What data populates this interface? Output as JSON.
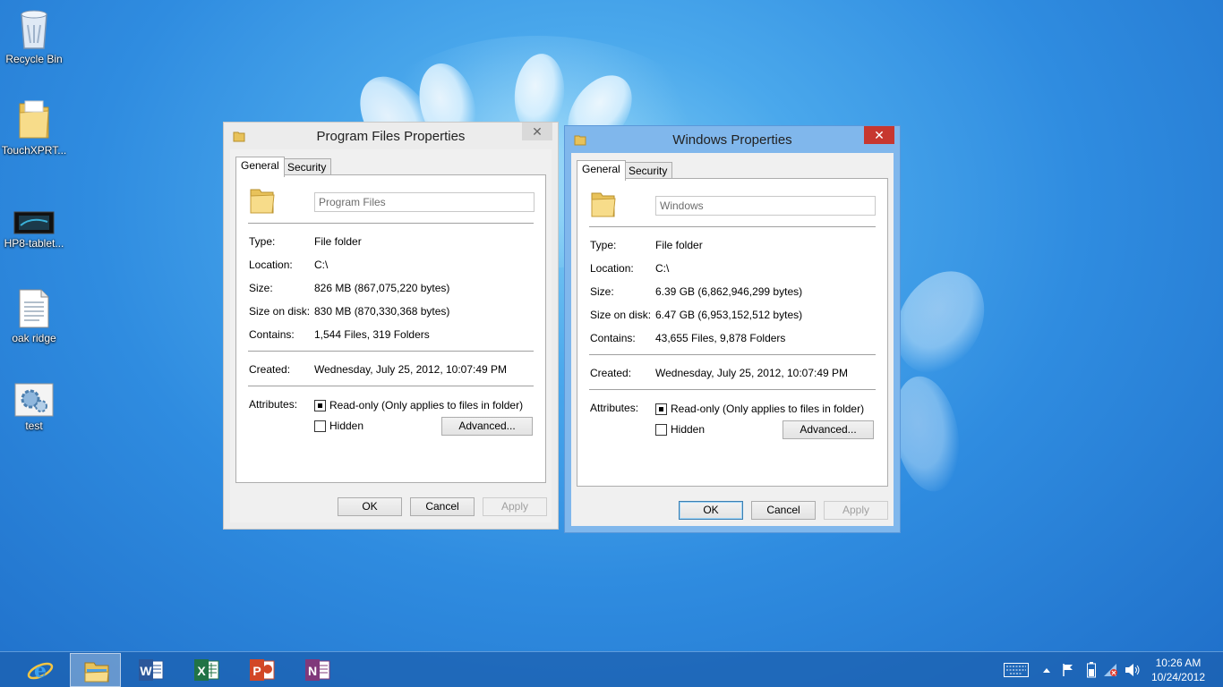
{
  "desktop": {
    "icons": [
      {
        "label": "Recycle Bin",
        "icon": "recycle-bin-icon"
      },
      {
        "label": "TouchXPRT...",
        "icon": "folder-icon"
      },
      {
        "label": "HP8-tablet...",
        "icon": "video-file-icon"
      },
      {
        "label": "oak ridge",
        "icon": "text-document-icon"
      },
      {
        "label": "test",
        "icon": "settings-file-icon"
      }
    ]
  },
  "dialog_program_files": {
    "title": "Program Files Properties",
    "close": "✕",
    "tabs": [
      "General",
      "Security"
    ],
    "name_value": "Program Files",
    "rows": [
      {
        "label": "Type:",
        "value": "File folder"
      },
      {
        "label": "Location:",
        "value": "C:\\"
      },
      {
        "label": "Size:",
        "value": "826 MB (867,075,220 bytes)"
      },
      {
        "label": "Size on disk:",
        "value": "830 MB (870,330,368 bytes)"
      },
      {
        "label": "Contains:",
        "value": "1,544 Files, 319 Folders"
      }
    ],
    "created_label": "Created:",
    "created_value": "Wednesday, July 25, 2012, 10:07:49 PM",
    "attributes_label": "Attributes:",
    "readonly_label": "Read-only (Only applies to files in folder)",
    "hidden_label": "Hidden",
    "advanced_label": "Advanced...",
    "ok_label": "OK",
    "cancel_label": "Cancel",
    "apply_label": "Apply"
  },
  "dialog_windows": {
    "title": "Windows Properties",
    "close": "✕",
    "tabs": [
      "General",
      "Security"
    ],
    "name_value": "Windows",
    "rows": [
      {
        "label": "Type:",
        "value": "File folder"
      },
      {
        "label": "Location:",
        "value": "C:\\"
      },
      {
        "label": "Size:",
        "value": "6.39 GB (6,862,946,299 bytes)"
      },
      {
        "label": "Size on disk:",
        "value": "6.47 GB (6,953,152,512 bytes)"
      },
      {
        "label": "Contains:",
        "value": "43,655 Files, 9,878 Folders"
      }
    ],
    "created_label": "Created:",
    "created_value": "Wednesday, July 25, 2012, 10:07:49 PM",
    "attributes_label": "Attributes:",
    "readonly_label": "Read-only (Only applies to files in folder)",
    "hidden_label": "Hidden",
    "advanced_label": "Advanced...",
    "ok_label": "OK",
    "cancel_label": "Cancel",
    "apply_label": "Apply"
  },
  "taskbar": {
    "apps": [
      {
        "icon": "internet-explorer-icon",
        "active": false
      },
      {
        "icon": "file-explorer-icon",
        "active": true
      },
      {
        "icon": "word-icon",
        "active": false
      },
      {
        "icon": "excel-icon",
        "active": false
      },
      {
        "icon": "powerpoint-icon",
        "active": false
      },
      {
        "icon": "onenote-icon",
        "active": false
      }
    ],
    "tray": {
      "keyboard_icon": "touch-keyboard-icon",
      "show_hidden_icon": "chevron-up-icon",
      "flag_icon": "action-center-flag-icon",
      "battery_icon": "battery-icon",
      "network_icon": "network-disconnected-icon",
      "volume_icon": "volume-icon"
    },
    "time": "10:26 AM",
    "date": "10/24/2012"
  },
  "colors": {
    "accent_active_title": "#80b7ec",
    "close_red": "#c7372f",
    "taskbar": "#1c5faf"
  }
}
